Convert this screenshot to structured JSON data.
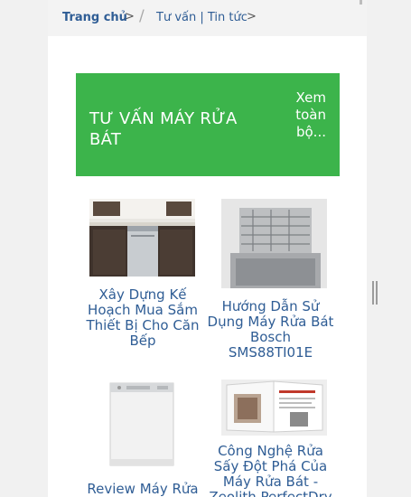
{
  "breadcrumb": {
    "home": "Trang chủ",
    "arrow": ">",
    "separator": "/",
    "section": "Tư vấn | Tin tức"
  },
  "banner": {
    "title": "TƯ VẤN MÁY RỬA BÁT",
    "more": "Xem toàn bộ..."
  },
  "articles": [
    {
      "title": "Xây Dựng Kế Hoạch Mua Sắm Thiết Bị Cho Căn Bếp",
      "image": "kitchen-dishwasher-photo"
    },
    {
      "title": "Hướng Dẫn Sử Dụng Máy Rửa Bát Bosch SMS88TI01E",
      "image": "open-dishwasher-rack-photo"
    },
    {
      "title": "Review Máy Rửa",
      "image": "white-dishwasher-photo"
    },
    {
      "title": "Công Nghệ Rửa Sấy Đột Phá Của Máy Rửa Bát - Zeolith PerfectDry",
      "image": "zeolith-brochure-photo"
    }
  ],
  "colors": {
    "banner_bg": "#3cb44b",
    "link": "#2f5d95",
    "page_bg": "#f1f1f1"
  }
}
